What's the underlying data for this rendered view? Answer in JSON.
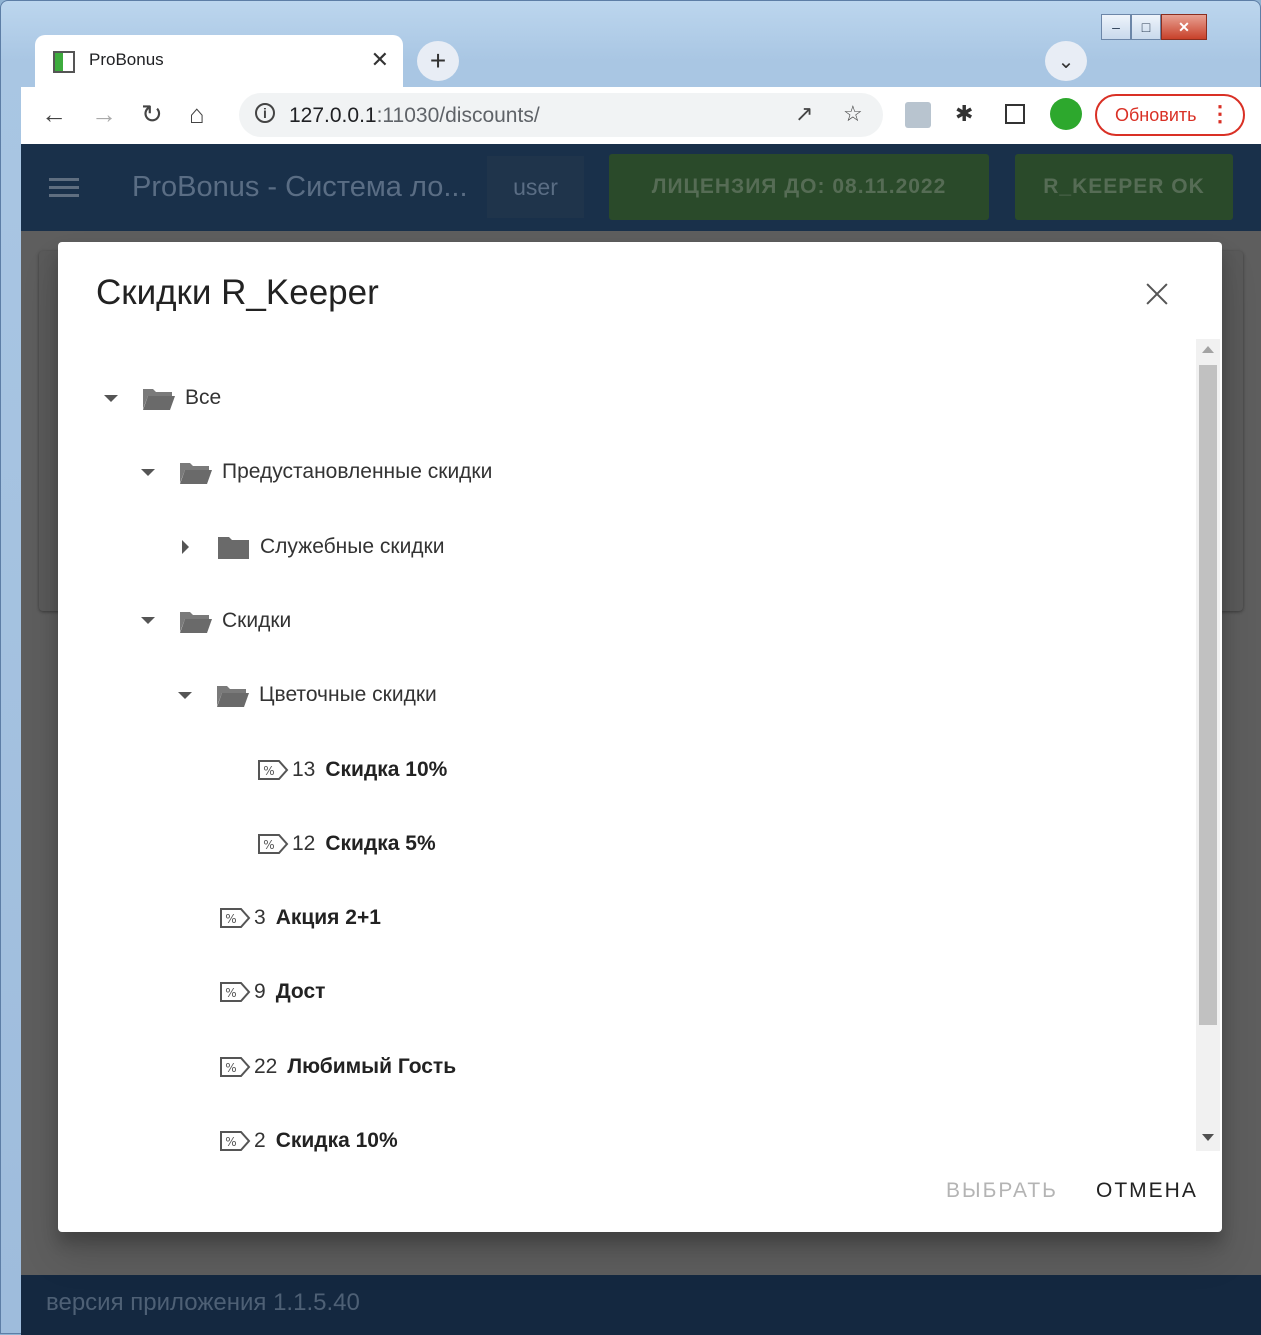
{
  "browser": {
    "tab_title": "ProBonus",
    "url_host": "127.0.0.1",
    "url_rest": ":11030/discounts/",
    "update_label": "Обновить"
  },
  "app": {
    "title": "ProBonus - Система ло...",
    "user": "user",
    "license": "ЛИЦЕНЗИЯ ДО: 08.11.2022",
    "rkeeper_status": "R_KEEPER OK",
    "version": "версия приложения 1.1.5.40"
  },
  "dialog": {
    "title": "Скидки R_Keeper",
    "select_label": "ВЫБРАТЬ",
    "cancel_label": "ОТМЕНА",
    "tree": [
      {
        "level": 0,
        "type": "folder",
        "expanded": true,
        "label": "Все"
      },
      {
        "level": 1,
        "type": "folder",
        "expanded": true,
        "label": "Предустановленные скидки"
      },
      {
        "level": 2,
        "type": "folder",
        "expanded": false,
        "label": "Служебные скидки"
      },
      {
        "level": 1,
        "type": "folder",
        "expanded": true,
        "label": "Скидки"
      },
      {
        "level": 2,
        "type": "folder",
        "expanded": true,
        "label": "Цветочные скидки"
      },
      {
        "level": 3,
        "type": "discount",
        "code": "13",
        "label": "Скидка 10%"
      },
      {
        "level": 3,
        "type": "discount",
        "code": "12",
        "label": "Скидка 5%"
      },
      {
        "level": 2,
        "type": "discount",
        "code": "3",
        "label": "Акция 2+1"
      },
      {
        "level": 2,
        "type": "discount",
        "code": "9",
        "label": "Дост"
      },
      {
        "level": 2,
        "type": "discount",
        "code": "22",
        "label": "Любимый Гость"
      },
      {
        "level": 2,
        "type": "discount",
        "code": "2",
        "label": "Скидка 10%"
      }
    ]
  }
}
